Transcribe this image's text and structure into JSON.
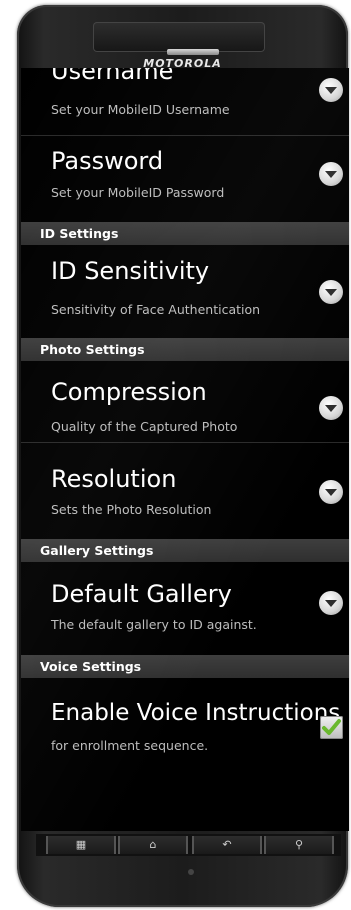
{
  "device": {
    "brand": "MOTOROLA"
  },
  "items": [
    {
      "title": "Username",
      "summary": "Set your MobileID Username",
      "control": "chevron"
    },
    {
      "title": "Password",
      "summary": "Set your MobileID Password",
      "control": "chevron"
    }
  ],
  "sections": {
    "id": {
      "header": "ID Settings",
      "items": [
        {
          "title": "ID Sensitivity",
          "summary": "Sensitivity of Face Authentication",
          "control": "chevron"
        }
      ]
    },
    "photo": {
      "header": "Photo Settings",
      "items": [
        {
          "title": "Compression",
          "summary": "Quality of the Captured Photo",
          "control": "chevron"
        },
        {
          "title": "Resolution",
          "summary": "Sets the Photo Resolution",
          "control": "chevron"
        }
      ]
    },
    "gallery": {
      "header": "Gallery Settings",
      "items": [
        {
          "title": "Default Gallery",
          "summary": "The default gallery to ID against.",
          "control": "chevron"
        }
      ]
    },
    "voice": {
      "header": "Voice Settings",
      "items": [
        {
          "title": "Enable Voice Instructions",
          "summary": "for enrollment sequence.",
          "control": "checkbox",
          "checked": true
        }
      ]
    }
  },
  "navbar": {
    "menu": "▦",
    "home": "⌂",
    "back": "↶",
    "search": "⚲"
  },
  "colors": {
    "check": "#6ab82e",
    "section_bg": "#383838"
  }
}
